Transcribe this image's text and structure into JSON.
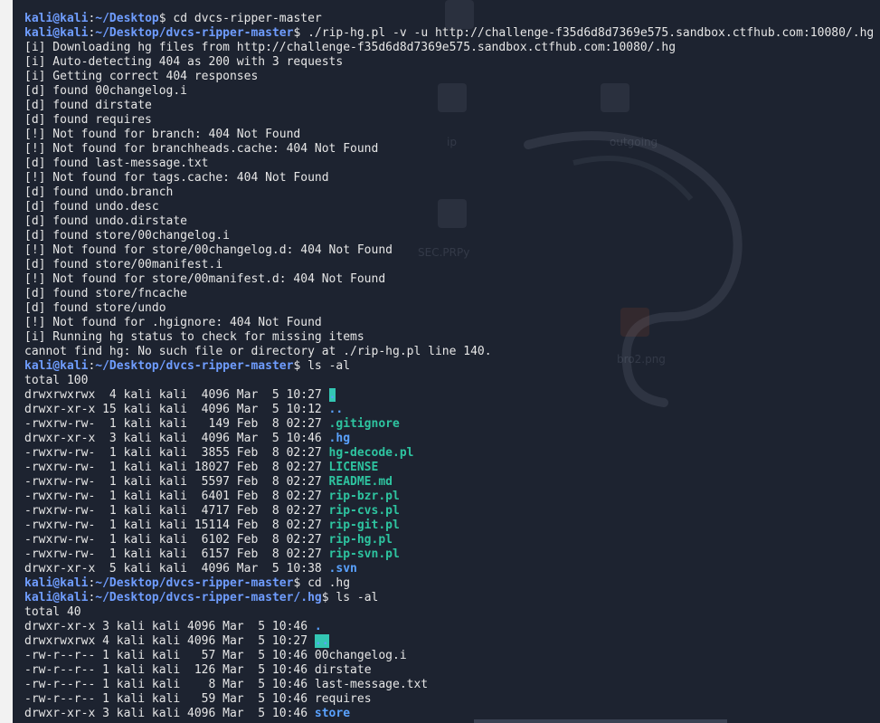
{
  "desktop": {
    "ghost_labels": [
      "ip",
      "outgoing",
      "SEC.PRPy",
      "bro2.png"
    ]
  },
  "terminal": {
    "lines": [
      {
        "type": "prompt",
        "user": "kali@kali",
        "path": "~/Desktop",
        "cmd": "cd dvcs-ripper-master"
      },
      {
        "type": "prompt",
        "user": "kali@kali",
        "path": "~/Desktop/dvcs-ripper-master",
        "cmd": "./rip-hg.pl -v -u http://challenge-f35d6d8d7369e575.sandbox.ctfhub.com:10080/.hg"
      },
      {
        "type": "text",
        "text": "[i] Downloading hg files from http://challenge-f35d6d8d7369e575.sandbox.ctfhub.com:10080/.hg"
      },
      {
        "type": "text",
        "text": "[i] Auto-detecting 404 as 200 with 3 requests"
      },
      {
        "type": "text",
        "text": "[i] Getting correct 404 responses"
      },
      {
        "type": "text",
        "text": "[d] found 00changelog.i"
      },
      {
        "type": "text",
        "text": "[d] found dirstate"
      },
      {
        "type": "text",
        "text": "[d] found requires"
      },
      {
        "type": "text",
        "text": "[!] Not found for branch: 404 Not Found"
      },
      {
        "type": "text",
        "text": "[!] Not found for branchheads.cache: 404 Not Found"
      },
      {
        "type": "text",
        "text": "[d] found last-message.txt"
      },
      {
        "type": "text",
        "text": "[!] Not found for tags.cache: 404 Not Found"
      },
      {
        "type": "text",
        "text": "[d] found undo.branch"
      },
      {
        "type": "text",
        "text": "[d] found undo.desc"
      },
      {
        "type": "text",
        "text": "[d] found undo.dirstate"
      },
      {
        "type": "text",
        "text": "[d] found store/00changelog.i"
      },
      {
        "type": "text",
        "text": "[!] Not found for store/00changelog.d: 404 Not Found"
      },
      {
        "type": "text",
        "text": "[d] found store/00manifest.i"
      },
      {
        "type": "text",
        "text": "[!] Not found for store/00manifest.d: 404 Not Found"
      },
      {
        "type": "text",
        "text": "[d] found store/fncache"
      },
      {
        "type": "text",
        "text": "[d] found store/undo"
      },
      {
        "type": "text",
        "text": "[!] Not found for .hgignore: 404 Not Found"
      },
      {
        "type": "text",
        "text": "[i] Running hg status to check for missing items"
      },
      {
        "type": "text",
        "text": "cannot find hg: No such file or directory at ./rip-hg.pl line 140."
      },
      {
        "type": "prompt",
        "user": "kali@kali",
        "path": "~/Desktop/dvcs-ripper-master",
        "cmd": "ls -al"
      },
      {
        "type": "text",
        "text": "total 100"
      },
      {
        "type": "ls",
        "prefix": "drwxrwxrwx  4 kali kali  4096 Mar  5 10:27 ",
        "name": ".",
        "kind": "hl-dir"
      },
      {
        "type": "ls",
        "prefix": "drwxr-xr-x 15 kali kali  4096 Mar  5 10:12 ",
        "name": "..",
        "kind": "dir"
      },
      {
        "type": "ls",
        "prefix": "-rwxrw-rw-  1 kali kali   149 Feb  8 02:27 ",
        "name": ".gitignore",
        "kind": "file"
      },
      {
        "type": "ls",
        "prefix": "drwxr-xr-x  3 kali kali  4096 Mar  5 10:46 ",
        "name": ".hg",
        "kind": "dir"
      },
      {
        "type": "ls",
        "prefix": "-rwxrw-rw-  1 kali kali  3855 Feb  8 02:27 ",
        "name": "hg-decode.pl",
        "kind": "file"
      },
      {
        "type": "ls",
        "prefix": "-rwxrw-rw-  1 kali kali 18027 Feb  8 02:27 ",
        "name": "LICENSE",
        "kind": "file"
      },
      {
        "type": "ls",
        "prefix": "-rwxrw-rw-  1 kali kali  5597 Feb  8 02:27 ",
        "name": "README.md",
        "kind": "file"
      },
      {
        "type": "ls",
        "prefix": "-rwxrw-rw-  1 kali kali  6401 Feb  8 02:27 ",
        "name": "rip-bzr.pl",
        "kind": "file"
      },
      {
        "type": "ls",
        "prefix": "-rwxrw-rw-  1 kali kali  4717 Feb  8 02:27 ",
        "name": "rip-cvs.pl",
        "kind": "file"
      },
      {
        "type": "ls",
        "prefix": "-rwxrw-rw-  1 kali kali 15114 Feb  8 02:27 ",
        "name": "rip-git.pl",
        "kind": "file"
      },
      {
        "type": "ls",
        "prefix": "-rwxrw-rw-  1 kali kali  6102 Feb  8 02:27 ",
        "name": "rip-hg.pl",
        "kind": "file"
      },
      {
        "type": "ls",
        "prefix": "-rwxrw-rw-  1 kali kali  6157 Feb  8 02:27 ",
        "name": "rip-svn.pl",
        "kind": "file"
      },
      {
        "type": "ls",
        "prefix": "drwxr-xr-x  5 kali kali  4096 Mar  5 10:38 ",
        "name": ".svn",
        "kind": "dir"
      },
      {
        "type": "prompt",
        "user": "kali@kali",
        "path": "~/Desktop/dvcs-ripper-master",
        "cmd": "cd .hg"
      },
      {
        "type": "prompt",
        "user": "kali@kali",
        "path": "~/Desktop/dvcs-ripper-master/.hg",
        "cmd": "ls -al"
      },
      {
        "type": "text",
        "text": "total 40"
      },
      {
        "type": "ls",
        "prefix": "drwxr-xr-x 3 kali kali 4096 Mar  5 10:46 ",
        "name": ".",
        "kind": "dir"
      },
      {
        "type": "ls",
        "prefix": "drwxrwxrwx 4 kali kali 4096 Mar  5 10:27 ",
        "name": "..",
        "kind": "hl-dir"
      },
      {
        "type": "ls",
        "prefix": "-rw-r--r-- 1 kali kali   57 Mar  5 10:46 ",
        "name": "00changelog.i",
        "kind": "plain"
      },
      {
        "type": "ls",
        "prefix": "-rw-r--r-- 1 kali kali  126 Mar  5 10:46 ",
        "name": "dirstate",
        "kind": "plain"
      },
      {
        "type": "ls",
        "prefix": "-rw-r--r-- 1 kali kali    8 Mar  5 10:46 ",
        "name": "last-message.txt",
        "kind": "plain"
      },
      {
        "type": "ls",
        "prefix": "-rw-r--r-- 1 kali kali   59 Mar  5 10:46 ",
        "name": "requires",
        "kind": "plain"
      },
      {
        "type": "ls",
        "prefix": "drwxr-xr-x 3 kali kali 4096 Mar  5 10:46 ",
        "name": "store",
        "kind": "dir"
      }
    ]
  },
  "colors": {
    "background": "#1d2330",
    "prompt": "#6f9dff",
    "directory": "#5aa2ff",
    "executable": "#2ec4a0",
    "highlight": "#33c6b3"
  }
}
